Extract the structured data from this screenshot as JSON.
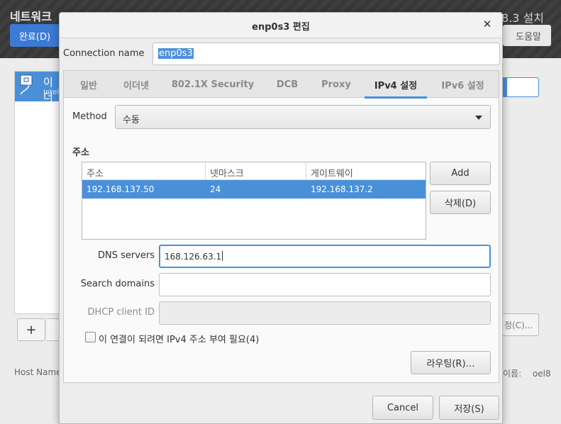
{
  "background": {
    "title": "네트워크",
    "install_label": "8.3 설치",
    "done_button": "완료(D)",
    "help_button": "도움말",
    "list_item_name": "이더",
    "list_item_sub": "Intel",
    "add_icon": "plus-icon",
    "host_name_label": "Host Name",
    "configure_button": "정(C)...",
    "host_name_right_label": "이름:",
    "host_name_value": "oel8"
  },
  "dialog": {
    "title": "enp0s3 편집",
    "close_icon": "close-icon",
    "connection_name_label": "Connection name",
    "connection_name_value": "enp0s3",
    "tabs": [
      {
        "label": "일반"
      },
      {
        "label": "이더넷"
      },
      {
        "label": "802.1X Security"
      },
      {
        "label": "DCB"
      },
      {
        "label": "Proxy"
      },
      {
        "label": "IPv4 설정",
        "active": true
      },
      {
        "label": "IPv6 설정"
      }
    ],
    "method_label": "Method",
    "method_value": "수동",
    "addresses_heading": "주소",
    "address_columns": [
      "주소",
      "넷마스크",
      "게이트웨이"
    ],
    "address_rows": [
      {
        "address": "192.168.137.50",
        "netmask": "24",
        "gateway": "192.168.137.2"
      }
    ],
    "add_button": "Add",
    "delete_button": "삭제(D)",
    "dns_label": "DNS servers",
    "dns_value": "168.126.63.1",
    "search_domains_label": "Search domains",
    "search_domains_value": "",
    "dhcp_client_id_label": "DHCP client ID",
    "dhcp_client_id_value": "",
    "require_ipv4_label": "이 연결이 되려면 IPv4 주소 부여 필요(4)",
    "require_ipv4_checked": false,
    "routes_button": "라우팅(R)…",
    "cancel_button": "Cancel",
    "save_button": "저장(S)"
  },
  "colors": {
    "accent": "#4a90d9",
    "header_bg": "#3a3a3a",
    "done_button_bg": "#3c7ad6"
  }
}
